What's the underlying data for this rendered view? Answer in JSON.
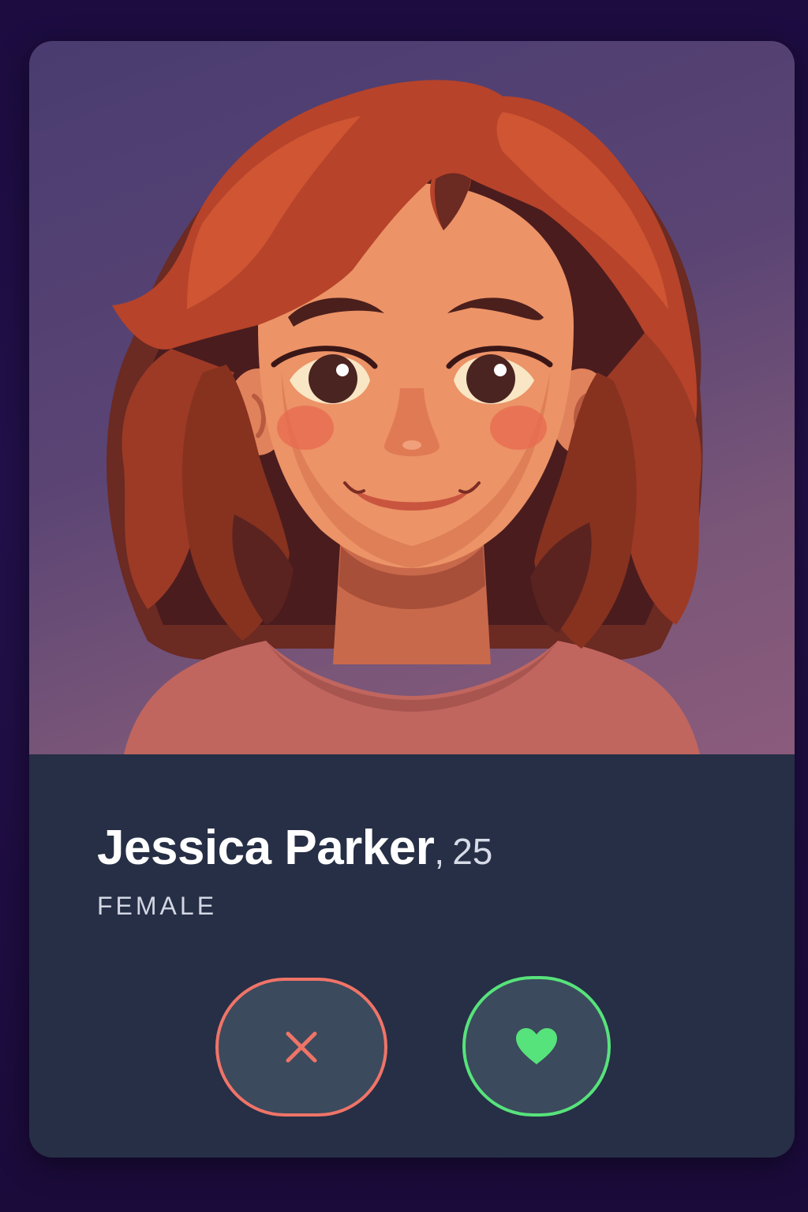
{
  "profile": {
    "name": "Jessica Parker",
    "separator": ",",
    "age": "25",
    "gender": "FEMALE"
  },
  "actions": {
    "dislike_icon": "close-icon",
    "like_icon": "heart-icon"
  },
  "colors": {
    "background": "#1c0c40",
    "card": "#262f45",
    "button_fill": "#3b4a5d",
    "dislike_accent": "#ef7468",
    "like_accent": "#57e37b",
    "name_text": "#ffffff"
  }
}
